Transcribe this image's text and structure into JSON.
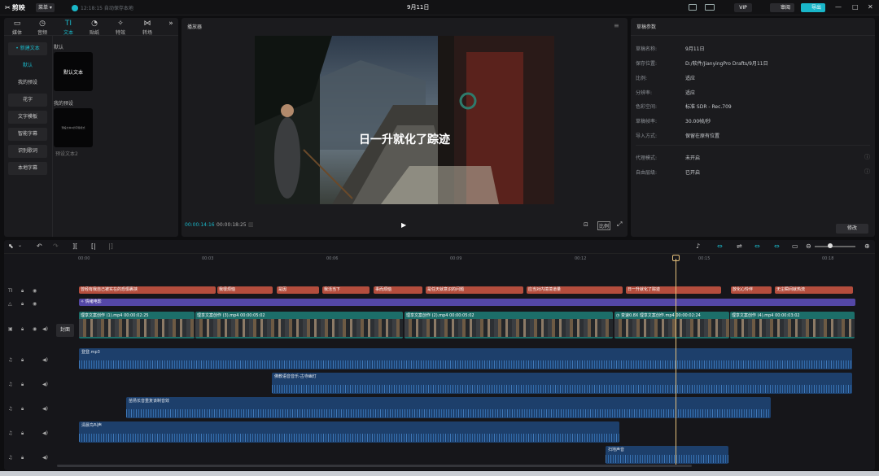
{
  "topbar": {
    "logo": "剪映",
    "menu": "菜单",
    "autosave": "12:18:15 自动保存本地",
    "title": "9月11日",
    "vip": "VIP",
    "review": "审阅",
    "export": "导出",
    "window_controls": [
      "—",
      "□",
      "✕"
    ]
  },
  "left_panel": {
    "tabs": [
      {
        "icon": "▭",
        "label": "媒体"
      },
      {
        "icon": "◷",
        "label": "音频"
      },
      {
        "icon": "TI",
        "label": "文本"
      },
      {
        "icon": "◔",
        "label": "贴纸"
      },
      {
        "icon": "✧",
        "label": "特效"
      },
      {
        "icon": "⋈",
        "label": "转场"
      },
      {
        "icon": "»",
        "label": ""
      }
    ],
    "active_tab": "文本",
    "nav": [
      {
        "label": "• 新建文本",
        "type": "main"
      },
      {
        "label": "默认",
        "type": "sub-sel"
      },
      {
        "label": "我的预设",
        "type": "sub"
      },
      {
        "label": "花字",
        "type": "main"
      },
      {
        "label": "文字模板",
        "type": "main"
      },
      {
        "label": "智能字幕",
        "type": "main"
      },
      {
        "label": "识别歌词",
        "type": "main"
      },
      {
        "label": "本地字幕",
        "type": "main"
      }
    ],
    "default_section": "默认",
    "default_card": "默认文本",
    "preset_section": "我的预设",
    "preset_card_text": "預設文本2的字體樣式",
    "preset_name": "预设文本2"
  },
  "player": {
    "title": "播放器",
    "subtitle": "日一升就化了踪迹",
    "time_current": "00:00:14:16",
    "time_total": "00:00:18:25",
    "ratio": "比例"
  },
  "params": {
    "title": "草稿参数",
    "rows": [
      {
        "k": "草稿名称:",
        "v": "9月11日"
      },
      {
        "k": "保存位置:",
        "v": "D:/软件/JianyingPro Drafts/9月11日"
      },
      {
        "k": "比例:",
        "v": "适应"
      },
      {
        "k": "分辨率:",
        "v": "适应"
      },
      {
        "k": "色彩空间:",
        "v": "标准 SDR - Rec.709"
      },
      {
        "k": "草稿帧率:",
        "v": "30.00帧/秒"
      },
      {
        "k": "导入方式:",
        "v": "保留在原有位置"
      },
      {
        "k": "代理模式:",
        "v": "未开启"
      },
      {
        "k": "自由层级:",
        "v": "已开启"
      }
    ],
    "edit": "修改"
  },
  "timeline": {
    "ticks": [
      "00:00",
      "00:03",
      "00:06",
      "00:09",
      "00:12",
      "00:15",
      "00:18"
    ],
    "cover": "封面",
    "text_clips": [
      {
        "label": "曾经有我自己被实在的恐惧裹挟",
        "l": 97,
        "w": 168
      },
      {
        "label": "我很烦恼",
        "l": 267,
        "w": 68
      },
      {
        "label": "是因",
        "l": 340,
        "w": 52
      },
      {
        "label": "我活当下",
        "l": 396,
        "w": 58
      },
      {
        "label": "事而烦恼",
        "l": 459,
        "w": 60
      },
      {
        "label": "是任天就意识的问题",
        "l": 523,
        "w": 120
      },
      {
        "label": "应当对内境境道量",
        "l": 647,
        "w": 118
      },
      {
        "label": "日一升就化了踪迹",
        "l": 769,
        "w": 117
      },
      {
        "label": "放化心怜伴",
        "l": 898,
        "w": 50
      },
      {
        "label": "无尘瞬间就热流",
        "l": 952,
        "w": 96
      }
    ],
    "fx_clip": "情绪电影",
    "video_clips": [
      {
        "label": "理享文案创作 (1).mp4  00:00:02:25",
        "l": 97,
        "w": 142
      },
      {
        "label": "理享文案创作 (3).mp4  00:00:05:02",
        "l": 240,
        "w": 255
      },
      {
        "label": "理享文案创作 (2).mp4  00:00:05:02",
        "l": 497,
        "w": 256
      },
      {
        "label": "◷ 变速0.8X  理享文案创作.mp4  00:00:02:24",
        "l": 755,
        "w": 141
      },
      {
        "label": "理享文案创作 (4).mp4  00:00:03:02",
        "l": 897,
        "w": 153
      }
    ],
    "audio_clips": [
      {
        "label": "登登.mp3",
        "l": 97,
        "t": 428,
        "w": 950,
        "h": 26
      },
      {
        "label": "佛教语音音乐-古寺幽灯",
        "l": 334,
        "t": 458,
        "w": 713,
        "h": 26
      },
      {
        "label": "苗扬长音重复该制音效",
        "l": 155,
        "t": 488,
        "w": 792,
        "h": 26
      },
      {
        "label": "清晨鸟叫声",
        "l": 97,
        "t": 518,
        "w": 664,
        "h": 26
      },
      {
        "label": "扫地声音",
        "l": 744,
        "t": 548,
        "w": 151,
        "h": 22
      }
    ]
  }
}
